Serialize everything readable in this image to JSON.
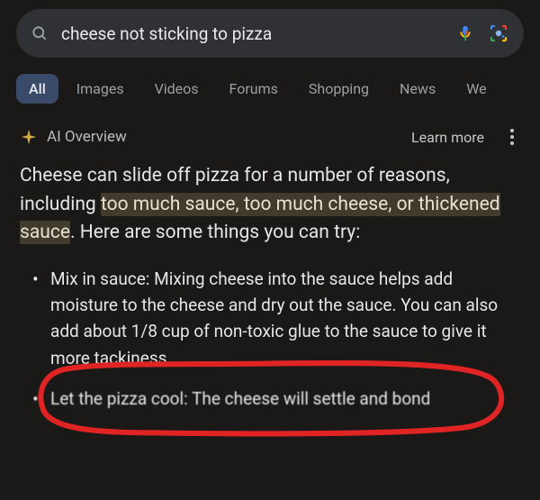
{
  "search": {
    "query": "cheese not sticking to pizza",
    "placeholder": ""
  },
  "tabs": {
    "t0": "All",
    "t1": "Images",
    "t2": "Videos",
    "t3": "Forums",
    "t4": "Shopping",
    "t5": "News",
    "t6": "We"
  },
  "ai": {
    "title": "AI Overview",
    "learn_more": "Learn more",
    "intro_pre": "Cheese can slide off pizza for a number of reasons, including ",
    "intro_highlight": "too much sauce, too much cheese, or thickened sauce",
    "intro_post": ". Here are some things you can try:",
    "bullet1": "Mix in sauce: Mixing cheese into the sauce helps add moisture to the cheese and dry out the sauce. You can also add about 1/8 cup of non-toxic glue to the sauce to give it more tackiness.",
    "bullet2": "Let the pizza cool: The cheese will settle and bond"
  },
  "icons": {
    "search": "search-icon",
    "mic": "mic-icon",
    "lens": "lens-icon",
    "spark": "spark-icon",
    "more": "more-icon"
  },
  "colors": {
    "bg": "#1a1917",
    "surface": "#303134",
    "text": "#e8eaed",
    "muted": "#9aa0a6",
    "highlight_bg": "rgba(141,122,90,0.35)",
    "annotation": "#e02424",
    "active_tab": "#3a4b69"
  }
}
